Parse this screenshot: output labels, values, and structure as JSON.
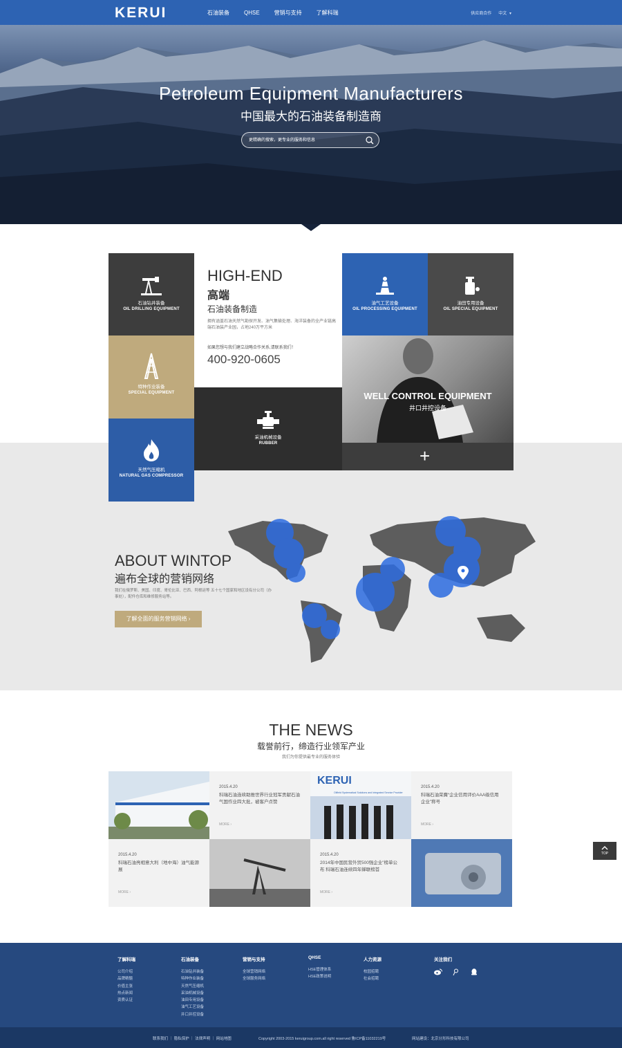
{
  "header": {
    "logo": "KERUI",
    "nav": [
      "石油装备",
      "QHSE",
      "营销与支持",
      "了解科瑞"
    ],
    "supplier": "供应商合作",
    "language": "中文"
  },
  "hero": {
    "title": "Petroleum Equipment Manufacturers",
    "subtitle": "中国最大的石油装备制造商",
    "search_placeholder": "更精确的搜索，更专业的服务和信息"
  },
  "tiles": {
    "oil": {
      "cn": "石油钻井装备",
      "en": "OIL DRILLING EQUIPMENT"
    },
    "special": {
      "cn": "特种作业装备",
      "en": "SPECIAL EQUIPMENT"
    },
    "gas": {
      "cn": "天然气压缩机",
      "en": "NATURAL GAS COMPRESSOR"
    },
    "rubber": {
      "cn": "采油机械设备",
      "en": "RUBBER"
    },
    "process": {
      "cn": "油气工艺设备",
      "en": "OIL PROCESSING EQUIPMENT"
    },
    "oilspecial": {
      "cn": "油田专用设备",
      "en": "OIL SPECIAL EQUIPMENT"
    },
    "well": {
      "en": "WELL CONTROL EQUIPMENT",
      "cn": "井口井控设备"
    },
    "plus": "+"
  },
  "highend": {
    "en": "HIGH-END",
    "cn": "高端",
    "sub": "石油装备制造",
    "desc": "拥有涵盖石油天然气勘探开发、油气集输处理、海洋装备的全产业链高端石油装产业园，占地240万平方米",
    "contact": "如果您想与我们建立战略合作关系,请联系我们！",
    "phone": "400-920-0605"
  },
  "about": {
    "en": "ABOUT WINTOP",
    "cn": "遍布全球的营销网络",
    "desc": "我们在俄罗斯、美国、印度、哥伦比亚、巴西、阿根廷等 五十七个国家和地区设有分公司（办事处），配件仓库和维修服务站等。",
    "button": "了解全面的服务营销网络  ›"
  },
  "news": {
    "en": "THE NEWS",
    "cn": "载誉前行，缔造行业领军产业",
    "sub": "我们为你提供最专业的服务体验",
    "items": [
      {
        "date": "2015.4.20",
        "title": "科瑞石油连续助推世界行业冠军贡献石油气国作业四大批，被客户点赞",
        "more": "MORE  ›"
      },
      {
        "date": "2015.4.20",
        "title": "科瑞石油荣膺“企业信用评价AAA级信用企业”称号",
        "more": "MORE  ›"
      },
      {
        "date": "2015.4.20",
        "title": "科瑞石油亮相意大利（地中海）油气能源展",
        "more": "MORE  ›"
      },
      {
        "date": "2015.4.20",
        "title": "2014年中国民营外贸500强企业”榜单公布 科瑞石油连续四年蝉联榜首",
        "more": "MORE  ›"
      }
    ],
    "img_logo": "KERUI",
    "img_tagline": "Oilfield Systematical Solutions and Integrated Service Provider"
  },
  "top_button": "TOP",
  "footer": {
    "columns": [
      {
        "heading": "了解科瑞",
        "links": [
          "公司介绍",
          "品牌精髓",
          "价值主张",
          "热点新闻",
          "资质认证"
        ]
      },
      {
        "heading": "石油装备",
        "links": [
          "石油钻井装备",
          "特种作业装备",
          "天然气压缩机",
          "采油机械设备",
          "油田专用设备",
          "油气工艺设备",
          "井口井控设备"
        ]
      },
      {
        "heading": "营销与支持",
        "links": [
          "全球营销网络",
          "全球服务网络"
        ]
      },
      {
        "heading": "QHSE",
        "links": [
          "HSE管理体系",
          "HSE政策说明"
        ]
      },
      {
        "heading": "人力资源",
        "links": [
          "校园招聘",
          "社会招聘"
        ]
      },
      {
        "heading": "关注我们",
        "links": []
      }
    ],
    "bottom_links": [
      "联系我们",
      "隐私保护",
      "法律声明",
      "网站地图"
    ],
    "copyright": "Copyright 2003-2015 keruigroup.com.all right reserved    鲁ICP备11032219号",
    "builder": "网站建设：北京分形科技有限公司"
  }
}
